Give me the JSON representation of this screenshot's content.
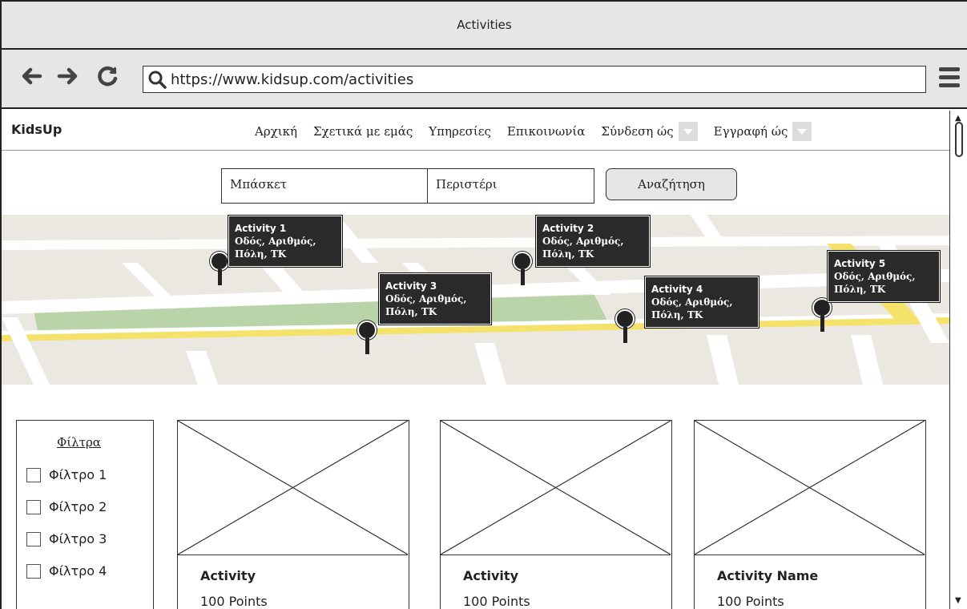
{
  "window": {
    "title": "Activities"
  },
  "browser": {
    "url": "https://www.kidsup.com/activities"
  },
  "site": {
    "brand": "KidsUp",
    "nav": [
      {
        "label": "Αρχική"
      },
      {
        "label": "Σχετικά με εμάς"
      },
      {
        "label": "Υπηρεσίες"
      },
      {
        "label": "Επικοινωνία"
      }
    ],
    "login_label": "Σύνδεση ώς",
    "register_label": "Εγγραφή ώς"
  },
  "search": {
    "activity_value": "Μπάσκετ",
    "location_value": "Περιστέρι",
    "button_label": "Αναζήτηση"
  },
  "map": {
    "markers": [
      {
        "title": "Activity 1",
        "address": "Οδός, Αριθμός,",
        "city": "Πόλη, ΤΚ"
      },
      {
        "title": "Activity 2",
        "address": "Οδός, Αριθμός,",
        "city": "Πόλη, ΤΚ"
      },
      {
        "title": "Activity 3",
        "address": "Οδός, Αριθμός,",
        "city": "Πόλη, ΤΚ"
      },
      {
        "title": "Activity 4",
        "address": "Οδός, Αριθμός,",
        "city": "Πόλη, ΤΚ"
      },
      {
        "title": "Activity 5",
        "address": "Οδός, Αριθμός,",
        "city": "Πόλη, ΤΚ"
      }
    ]
  },
  "filters": {
    "heading": "Φίλτρα",
    "items": [
      {
        "label": "Φίλτρο 1"
      },
      {
        "label": "Φίλτρο 2"
      },
      {
        "label": "Φίλτρο 3"
      },
      {
        "label": "Φίλτρο 4"
      }
    ]
  },
  "cards": [
    {
      "name": "Activity",
      "points": "100 Points"
    },
    {
      "name": "Activity",
      "points": "100 Points"
    },
    {
      "name": "Activity Name",
      "points": "100 Points"
    }
  ]
}
